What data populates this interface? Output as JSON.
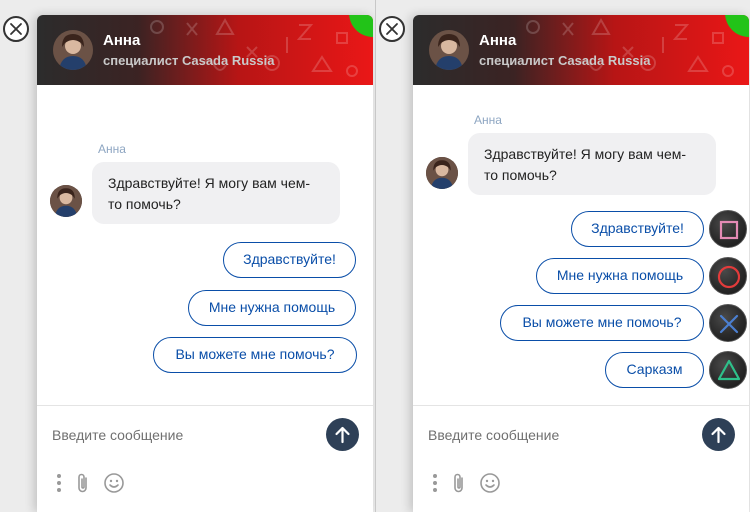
{
  "panels": [
    {
      "agent": {
        "name": "Анна",
        "role": "специалист Casada Russia"
      },
      "sender_label": "Анна",
      "message": "Здравствуйте! Я могу вам чем-то помочь?",
      "quick_replies": [
        {
          "label": "Здравствуйте!"
        },
        {
          "label": "Мне нужна помощь"
        },
        {
          "label": "Вы можете мне помочь?"
        }
      ],
      "input_placeholder": "Введите сообщение"
    },
    {
      "agent": {
        "name": "Анна",
        "role": "специалист Casada Russia"
      },
      "sender_label": "Анна",
      "message": "Здравствуйте! Я могу вам чем-то помочь?",
      "quick_replies": [
        {
          "label": "Здравствуйте!",
          "button_icon": "square-icon"
        },
        {
          "label": "Мне нужна помощь",
          "button_icon": "circle-icon"
        },
        {
          "label": "Вы можете мне помочь?",
          "button_icon": "cross-icon"
        },
        {
          "label": "Сарказм",
          "button_icon": "triangle-icon"
        }
      ],
      "input_placeholder": "Введите сообщение"
    }
  ],
  "colors": {
    "accent_blue": "#0a4ea8",
    "send_button": "#2e4057",
    "header_red": "#ea1717",
    "corner_green": "#22c318",
    "ps_square": "#e48bb5",
    "ps_circle": "#e23b3b",
    "ps_cross": "#4b7fd1",
    "ps_triangle": "#2ec08a"
  }
}
